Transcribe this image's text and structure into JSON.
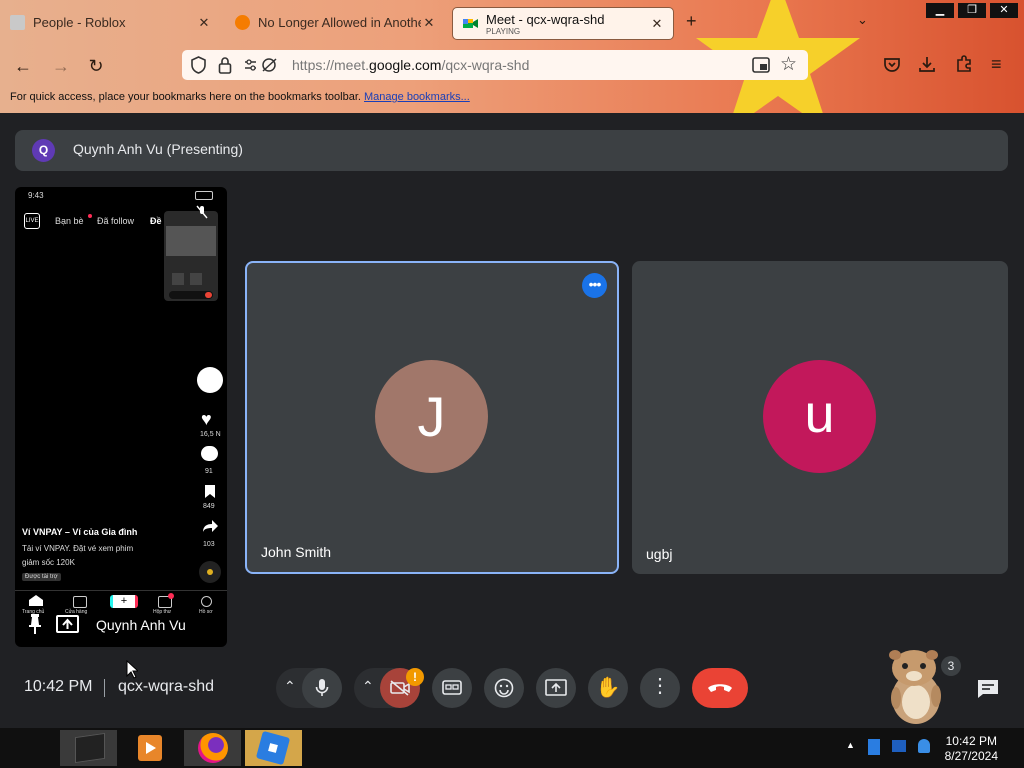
{
  "browser": {
    "tabs": [
      {
        "title": "People - Roblox",
        "close": "✕"
      },
      {
        "title": "No Longer Allowed in Another",
        "close": "✕"
      },
      {
        "title": "Meet - qcx-wqra-shd",
        "status": "PLAYING",
        "close": "✕"
      }
    ],
    "new_tab": "+",
    "url_prefix": "https://meet.",
    "url_domain": "google.com",
    "url_path": "/qcx-wqra-shd",
    "bookmarks_text": "For quick access, place your bookmarks here on the bookmarks toolbar.",
    "bookmarks_link": "Manage bookmarks..."
  },
  "meet": {
    "presenting_initial": "Q",
    "presenting_label": "Quynh Anh Vu (Presenting)",
    "presenter_name": "Quynh Anh Vu",
    "participants": [
      {
        "name": "John Smith",
        "initial": "J",
        "color": "#a1776a"
      },
      {
        "name": "ugbj",
        "initial": "u",
        "color": "#c2185b"
      }
    ],
    "time": "10:42 PM",
    "meeting_code": "qcx-wqra-shd",
    "people_count": "3",
    "camera_alert": "!"
  },
  "phone": {
    "status_time": "9:43",
    "tab_friends": "Bạn bè",
    "tab_following": "Đã follow",
    "tab_foryou": "Đề",
    "likes": "16,5 N",
    "comments": "91",
    "saves": "849",
    "shares": "103",
    "caption_title": "Ví VNPAY – Ví của Gia đình",
    "caption_line1": "Tải ví VNPAY. Đặt vé xem phim",
    "caption_line2": "giảm sốc 120K",
    "caption_tag": "Được tài trợ",
    "nav": [
      "Trang chủ",
      "Cửa hàng",
      "Hộp thư",
      "Hồ sơ"
    ]
  },
  "taskbar": {
    "time": "10:42 PM",
    "date": "8/27/2024"
  }
}
